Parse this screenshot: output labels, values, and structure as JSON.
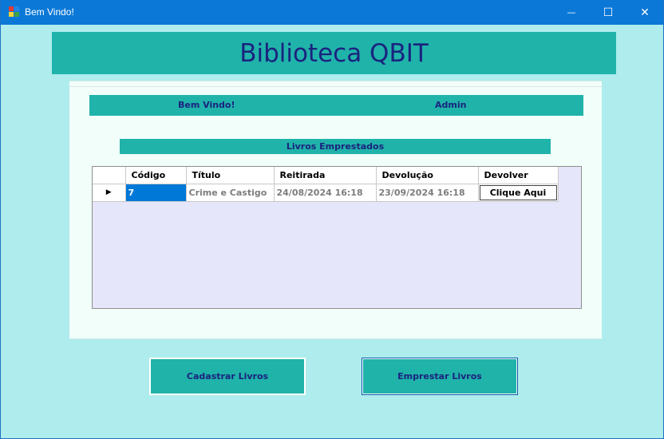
{
  "window": {
    "title": "Bem Vindo!",
    "minimize_glyph": "—",
    "maximize_glyph": "☐",
    "close_glyph": "✕",
    "app_icon": "app-window-icon"
  },
  "header": {
    "title": "Biblioteca QBIT"
  },
  "welcome": {
    "greeting": "Bem Vindo!",
    "user": "Admin"
  },
  "loans": {
    "title": "Livros Emprestados",
    "columns": [
      "Código",
      "Título",
      "Reitirada",
      "Devolução",
      "Devolver"
    ],
    "rows": [
      {
        "selector": "▶",
        "codigo": "7",
        "titulo": "Crime e Castigo",
        "retirada": "24/08/2024 16:18",
        "devolucao": "23/09/2024 16:18",
        "devolver": "Clique Aqui"
      }
    ]
  },
  "actions": {
    "cadastrar": "Cadastrar Livros",
    "emprestar": "Emprestar Livros"
  },
  "colors": {
    "accent": "#20b3aa",
    "text_dark": "#1a237e",
    "background": "#aeeced",
    "titlebar": "#0b78d7"
  }
}
